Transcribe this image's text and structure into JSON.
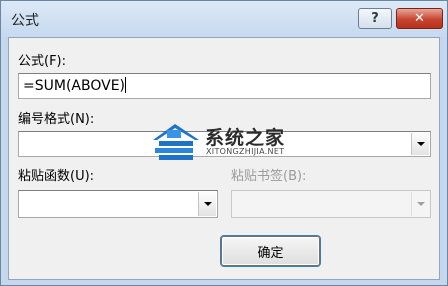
{
  "window": {
    "title": "公式",
    "help_glyph": "?",
    "close_glyph": "✕"
  },
  "formula": {
    "label": "公式(F):",
    "value": "=SUM(ABOVE)"
  },
  "number_format": {
    "label": "编号格式(N):",
    "value": ""
  },
  "paste_function": {
    "label": "粘贴函数(U):",
    "value": ""
  },
  "paste_bookmark": {
    "label": "粘贴书签(B):",
    "value": ""
  },
  "ok_button": {
    "label": "确定"
  },
  "watermark": {
    "name": "系统之家",
    "url": "XITONGZHIJIA.NET"
  },
  "colors": {
    "close_button": "#c7452f",
    "accent_focus": "#3c7fb1",
    "logo_blue": "#1e73c8"
  }
}
